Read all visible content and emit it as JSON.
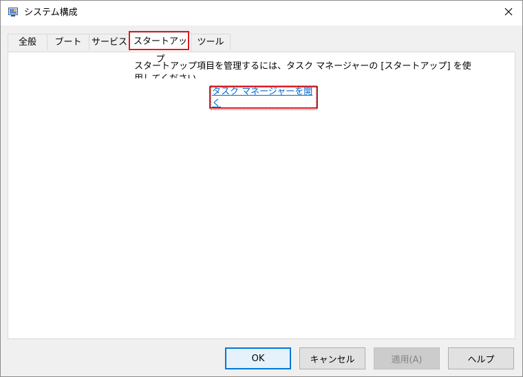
{
  "window": {
    "title": "システム構成",
    "app_icon": "monitor-settings-icon",
    "close_icon": "close-icon"
  },
  "tabs": [
    {
      "label": "全般",
      "active": false
    },
    {
      "label": "ブート",
      "active": false
    },
    {
      "label": "サービス",
      "active": false
    },
    {
      "label": "スタートアップ",
      "active": true
    },
    {
      "label": "ツール",
      "active": false
    }
  ],
  "startup_panel": {
    "description": "スタートアップ項目を管理するには、タスク マネージャーの [スタートアップ] を使用してください",
    "open_task_manager_link": "タスク マネージャーを開く"
  },
  "buttons": {
    "ok": "OK",
    "cancel": "キャンセル",
    "apply": "適用(A)",
    "help": "ヘルプ"
  },
  "colors": {
    "highlight": "#e0191f",
    "link": "#0066cc",
    "default_button_border": "#0078d7"
  }
}
